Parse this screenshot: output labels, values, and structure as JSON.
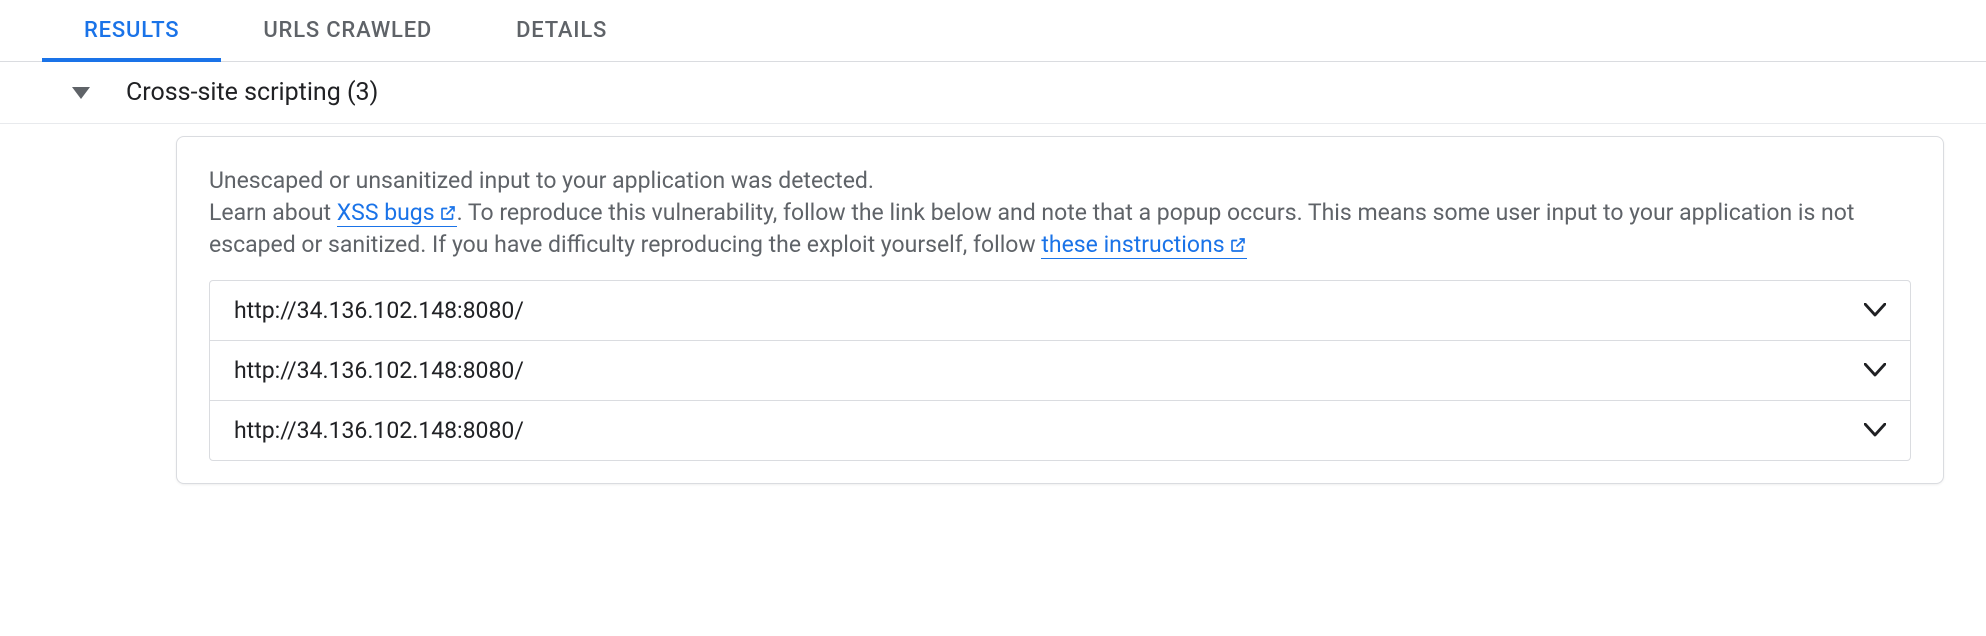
{
  "tabs": [
    {
      "label": "RESULTS",
      "active": true
    },
    {
      "label": "URLS CRAWLED",
      "active": false
    },
    {
      "label": "DETAILS",
      "active": false
    }
  ],
  "finding": {
    "title": "Cross-site scripting (3)",
    "description_pre": "Unescaped or unsanitized input to your application was detected.",
    "learn_about_prefix": "Learn about ",
    "link1_text": "XSS bugs",
    "description_mid": ". To reproduce this vulnerability, follow the link below and note that a popup occurs. This means some user input to your application is not escaped or sanitized. If you have difficulty reproducing the exploit yourself, follow ",
    "link2_text": "these instructions",
    "urls": [
      "http://34.136.102.148:8080/",
      "http://34.136.102.148:8080/",
      "http://34.136.102.148:8080/"
    ]
  }
}
